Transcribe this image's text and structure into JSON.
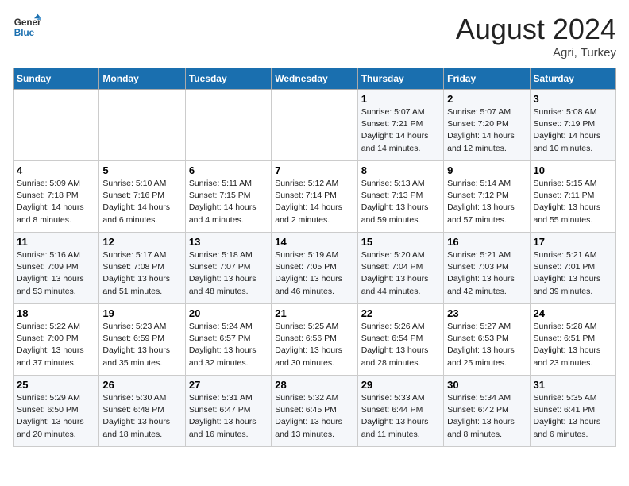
{
  "header": {
    "logo_text_general": "General",
    "logo_text_blue": "Blue",
    "month": "August 2024",
    "location": "Agri, Turkey"
  },
  "weekdays": [
    "Sunday",
    "Monday",
    "Tuesday",
    "Wednesday",
    "Thursday",
    "Friday",
    "Saturday"
  ],
  "weeks": [
    [
      {
        "day": "",
        "info": ""
      },
      {
        "day": "",
        "info": ""
      },
      {
        "day": "",
        "info": ""
      },
      {
        "day": "",
        "info": ""
      },
      {
        "day": "1",
        "info": "Sunrise: 5:07 AM\nSunset: 7:21 PM\nDaylight: 14 hours\nand 14 minutes."
      },
      {
        "day": "2",
        "info": "Sunrise: 5:07 AM\nSunset: 7:20 PM\nDaylight: 14 hours\nand 12 minutes."
      },
      {
        "day": "3",
        "info": "Sunrise: 5:08 AM\nSunset: 7:19 PM\nDaylight: 14 hours\nand 10 minutes."
      }
    ],
    [
      {
        "day": "4",
        "info": "Sunrise: 5:09 AM\nSunset: 7:18 PM\nDaylight: 14 hours\nand 8 minutes."
      },
      {
        "day": "5",
        "info": "Sunrise: 5:10 AM\nSunset: 7:16 PM\nDaylight: 14 hours\nand 6 minutes."
      },
      {
        "day": "6",
        "info": "Sunrise: 5:11 AM\nSunset: 7:15 PM\nDaylight: 14 hours\nand 4 minutes."
      },
      {
        "day": "7",
        "info": "Sunrise: 5:12 AM\nSunset: 7:14 PM\nDaylight: 14 hours\nand 2 minutes."
      },
      {
        "day": "8",
        "info": "Sunrise: 5:13 AM\nSunset: 7:13 PM\nDaylight: 13 hours\nand 59 minutes."
      },
      {
        "day": "9",
        "info": "Sunrise: 5:14 AM\nSunset: 7:12 PM\nDaylight: 13 hours\nand 57 minutes."
      },
      {
        "day": "10",
        "info": "Sunrise: 5:15 AM\nSunset: 7:11 PM\nDaylight: 13 hours\nand 55 minutes."
      }
    ],
    [
      {
        "day": "11",
        "info": "Sunrise: 5:16 AM\nSunset: 7:09 PM\nDaylight: 13 hours\nand 53 minutes."
      },
      {
        "day": "12",
        "info": "Sunrise: 5:17 AM\nSunset: 7:08 PM\nDaylight: 13 hours\nand 51 minutes."
      },
      {
        "day": "13",
        "info": "Sunrise: 5:18 AM\nSunset: 7:07 PM\nDaylight: 13 hours\nand 48 minutes."
      },
      {
        "day": "14",
        "info": "Sunrise: 5:19 AM\nSunset: 7:05 PM\nDaylight: 13 hours\nand 46 minutes."
      },
      {
        "day": "15",
        "info": "Sunrise: 5:20 AM\nSunset: 7:04 PM\nDaylight: 13 hours\nand 44 minutes."
      },
      {
        "day": "16",
        "info": "Sunrise: 5:21 AM\nSunset: 7:03 PM\nDaylight: 13 hours\nand 42 minutes."
      },
      {
        "day": "17",
        "info": "Sunrise: 5:21 AM\nSunset: 7:01 PM\nDaylight: 13 hours\nand 39 minutes."
      }
    ],
    [
      {
        "day": "18",
        "info": "Sunrise: 5:22 AM\nSunset: 7:00 PM\nDaylight: 13 hours\nand 37 minutes."
      },
      {
        "day": "19",
        "info": "Sunrise: 5:23 AM\nSunset: 6:59 PM\nDaylight: 13 hours\nand 35 minutes."
      },
      {
        "day": "20",
        "info": "Sunrise: 5:24 AM\nSunset: 6:57 PM\nDaylight: 13 hours\nand 32 minutes."
      },
      {
        "day": "21",
        "info": "Sunrise: 5:25 AM\nSunset: 6:56 PM\nDaylight: 13 hours\nand 30 minutes."
      },
      {
        "day": "22",
        "info": "Sunrise: 5:26 AM\nSunset: 6:54 PM\nDaylight: 13 hours\nand 28 minutes."
      },
      {
        "day": "23",
        "info": "Sunrise: 5:27 AM\nSunset: 6:53 PM\nDaylight: 13 hours\nand 25 minutes."
      },
      {
        "day": "24",
        "info": "Sunrise: 5:28 AM\nSunset: 6:51 PM\nDaylight: 13 hours\nand 23 minutes."
      }
    ],
    [
      {
        "day": "25",
        "info": "Sunrise: 5:29 AM\nSunset: 6:50 PM\nDaylight: 13 hours\nand 20 minutes."
      },
      {
        "day": "26",
        "info": "Sunrise: 5:30 AM\nSunset: 6:48 PM\nDaylight: 13 hours\nand 18 minutes."
      },
      {
        "day": "27",
        "info": "Sunrise: 5:31 AM\nSunset: 6:47 PM\nDaylight: 13 hours\nand 16 minutes."
      },
      {
        "day": "28",
        "info": "Sunrise: 5:32 AM\nSunset: 6:45 PM\nDaylight: 13 hours\nand 13 minutes."
      },
      {
        "day": "29",
        "info": "Sunrise: 5:33 AM\nSunset: 6:44 PM\nDaylight: 13 hours\nand 11 minutes."
      },
      {
        "day": "30",
        "info": "Sunrise: 5:34 AM\nSunset: 6:42 PM\nDaylight: 13 hours\nand 8 minutes."
      },
      {
        "day": "31",
        "info": "Sunrise: 5:35 AM\nSunset: 6:41 PM\nDaylight: 13 hours\nand 6 minutes."
      }
    ]
  ]
}
